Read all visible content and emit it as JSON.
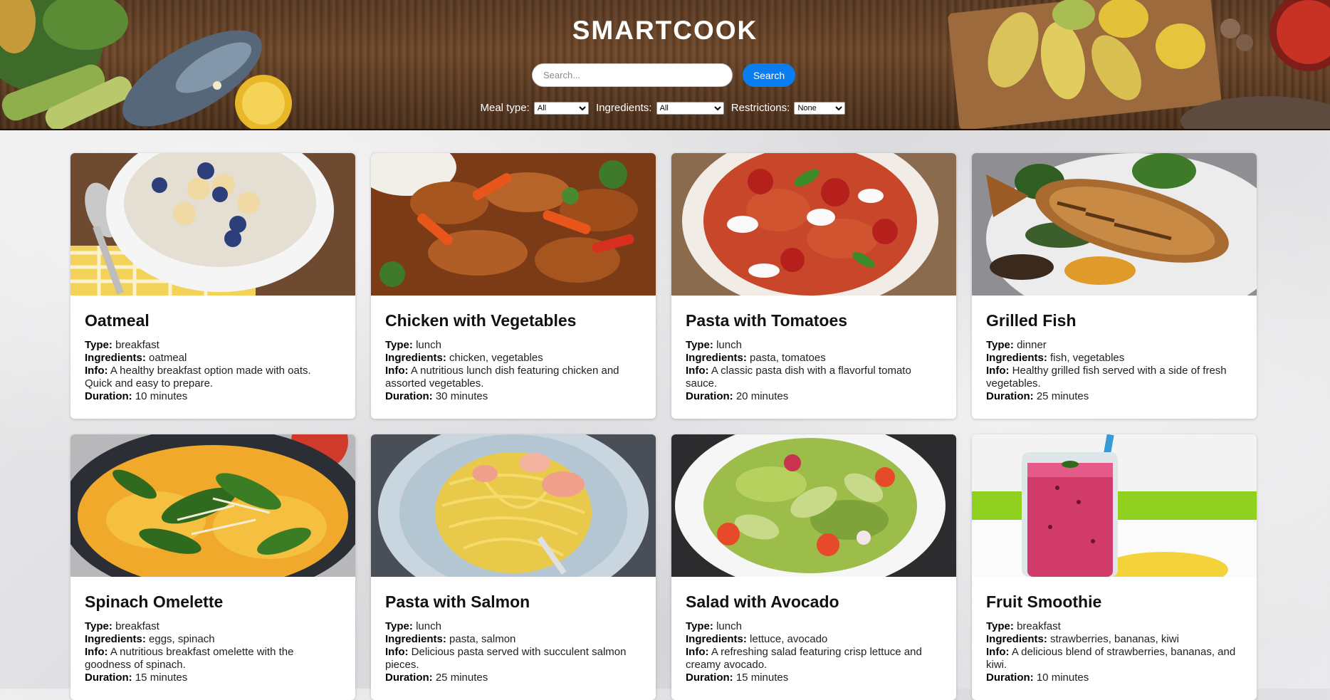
{
  "header": {
    "title": "SMARTCOOK",
    "search_placeholder": "Search...",
    "search_button": "Search",
    "filters": [
      {
        "label": "Meal type:",
        "selected": "All"
      },
      {
        "label": "Ingredients:",
        "selected": "All"
      },
      {
        "label": "Restrictions:",
        "selected": "None"
      }
    ]
  },
  "labels": {
    "type": "Type:",
    "ingredients": "Ingredients:",
    "info": "Info:",
    "duration": "Duration:"
  },
  "recipes": [
    {
      "name": "Oatmeal",
      "type": "breakfast",
      "ingredients": "oatmeal",
      "info": "A healthy breakfast option made with oats. Quick and easy to prepare.",
      "duration": "10 minutes",
      "image": "oatmeal-bowl-image"
    },
    {
      "name": "Chicken with Vegetables",
      "type": "lunch",
      "ingredients": "chicken, vegetables",
      "info": "A nutritious lunch dish featuring chicken and assorted vegetables.",
      "duration": "30 minutes",
      "image": "chicken-stirfry-image"
    },
    {
      "name": "Pasta with Tomatoes",
      "type": "lunch",
      "ingredients": "pasta, tomatoes",
      "info": "A classic pasta dish with a flavorful tomato sauce.",
      "duration": "20 minutes",
      "image": "pasta-tomato-image"
    },
    {
      "name": "Grilled Fish",
      "type": "dinner",
      "ingredients": "fish, vegetables",
      "info": "Healthy grilled fish served with a side of fresh vegetables.",
      "duration": "25 minutes",
      "image": "grilled-fish-image"
    },
    {
      "name": "Spinach Omelette",
      "type": "breakfast",
      "ingredients": "eggs, spinach",
      "info": "A nutritious breakfast omelette with the goodness of spinach.",
      "duration": "15 minutes",
      "image": "spinach-omelette-image"
    },
    {
      "name": "Pasta with Salmon",
      "type": "lunch",
      "ingredients": "pasta, salmon",
      "info": "Delicious pasta served with succulent salmon pieces.",
      "duration": "25 minutes",
      "image": "pasta-salmon-image"
    },
    {
      "name": "Salad with Avocado",
      "type": "lunch",
      "ingredients": "lettuce, avocado",
      "info": "A refreshing salad featuring crisp lettuce and creamy avocado.",
      "duration": "15 minutes",
      "image": "avocado-salad-image"
    },
    {
      "name": "Fruit Smoothie",
      "type": "breakfast",
      "ingredients": "strawberries, bananas, kiwi",
      "info": "A delicious blend of strawberries, bananas, and kiwi.",
      "duration": "10 minutes",
      "image": "fruit-smoothie-image"
    }
  ]
}
